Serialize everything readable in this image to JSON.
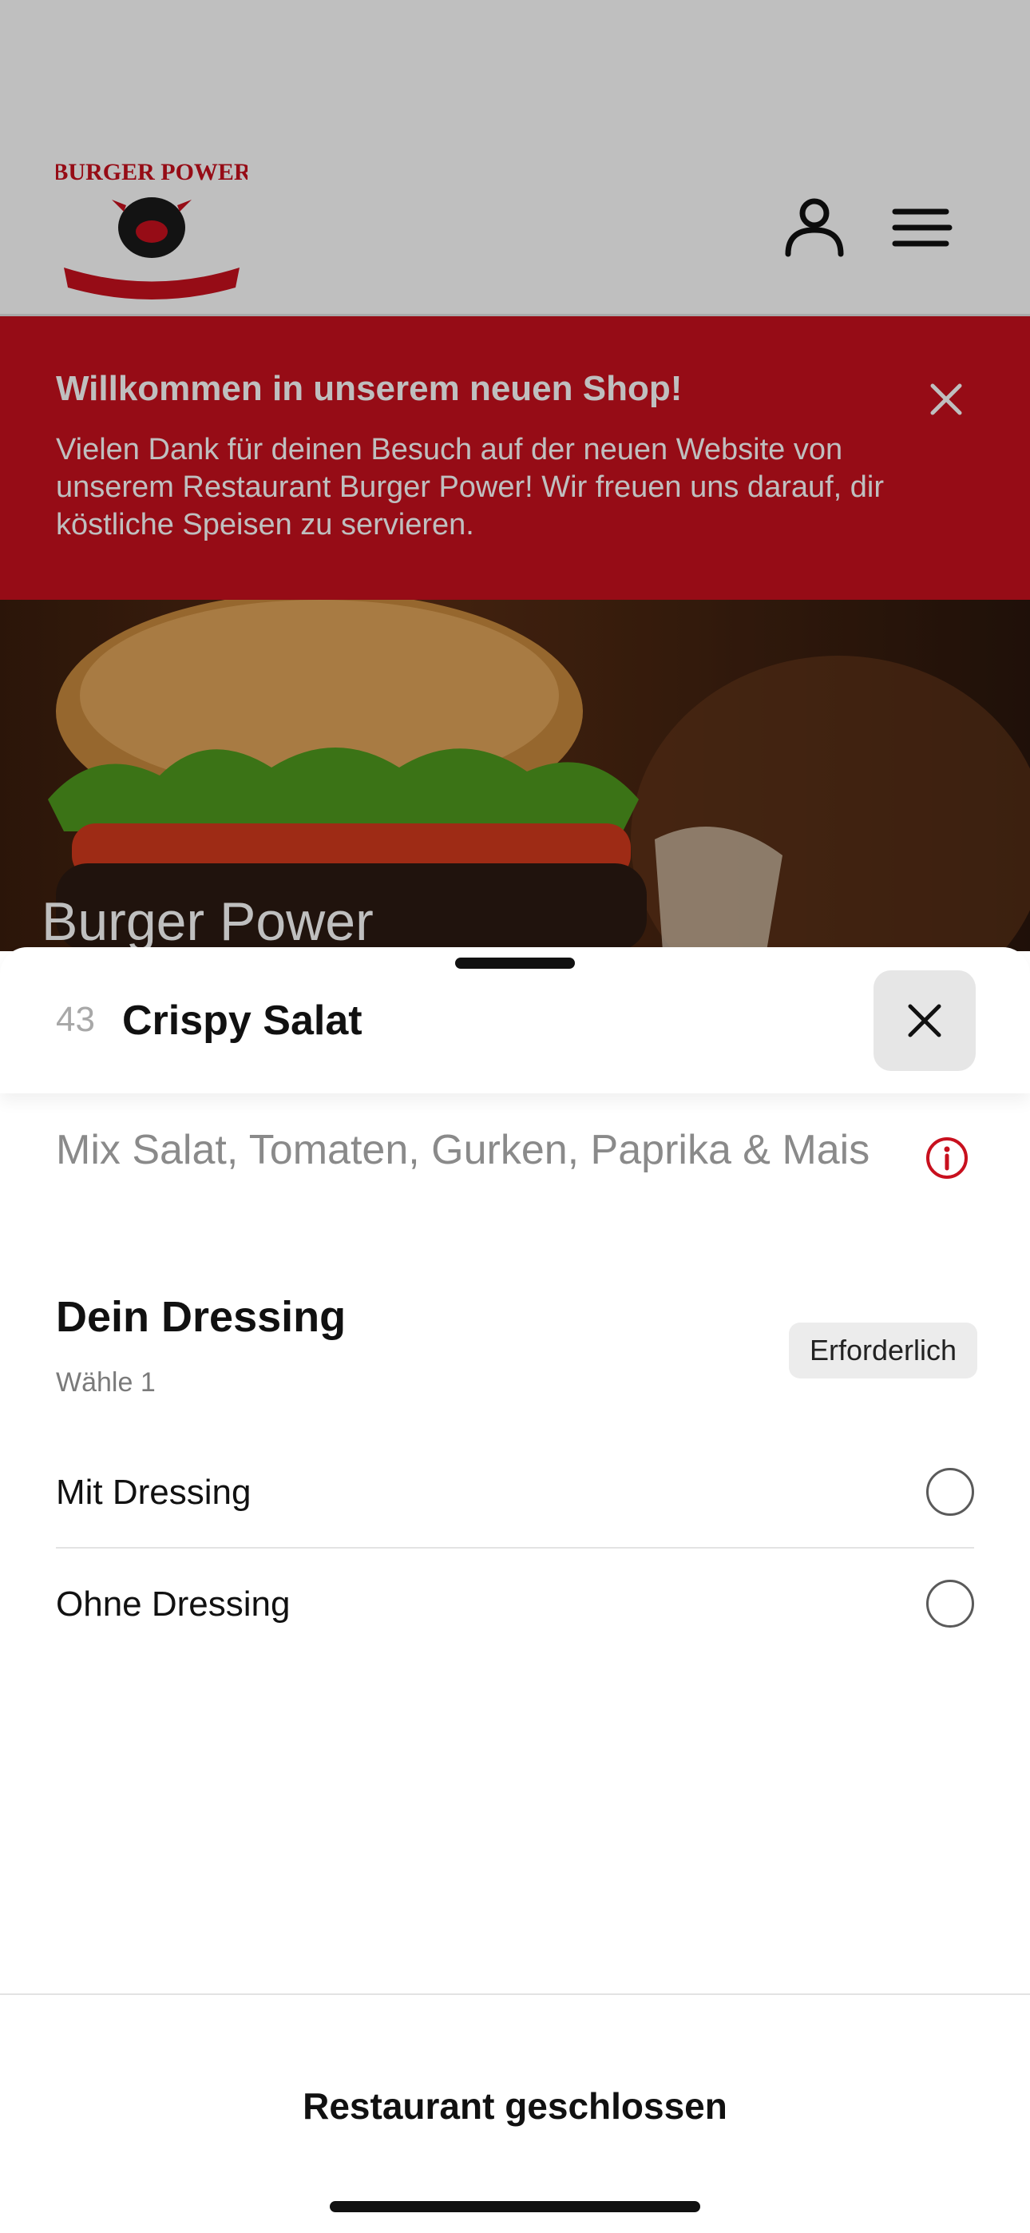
{
  "header": {
    "logo_text": "BURGER POWER",
    "user_icon": "user-icon",
    "menu_icon": "menu-icon"
  },
  "banner": {
    "title": "Willkommen in unserem neuen Shop!",
    "text": "Vielen Dank für deinen Besuch auf der neuen Website von unserem Restaurant Burger Power! Wir freuen uns darauf, dir köstliche Speisen zu servieren.",
    "close_icon": "close-icon",
    "color": "#c8101e"
  },
  "hero": {
    "title": "Burger Power"
  },
  "sheet": {
    "item_number": "43",
    "item_name": "Crispy Salat",
    "description": "Mix Salat, Tomaten, Gurken, Paprika & Mais",
    "info_icon": "info-icon",
    "section": {
      "title": "Dein Dressing",
      "subtitle": "Wähle 1",
      "badge": "Erforderlich"
    },
    "options": [
      {
        "label": "Mit Dressing",
        "selected": false
      },
      {
        "label": "Ohne Dressing",
        "selected": false
      }
    ],
    "footer_button": "Restaurant geschlossen"
  }
}
